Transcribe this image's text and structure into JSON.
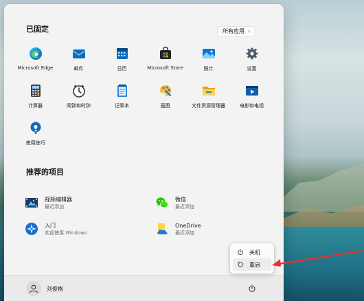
{
  "pinned": {
    "title": "已固定",
    "all_apps": "所有应用",
    "apps": [
      {
        "label": "Microsoft Edge",
        "icon": "edge-icon"
      },
      {
        "label": "邮件",
        "icon": "mail-icon"
      },
      {
        "label": "日历",
        "icon": "calendar-icon"
      },
      {
        "label": "Microsoft Store",
        "icon": "store-icon"
      },
      {
        "label": "照片",
        "icon": "photos-icon"
      },
      {
        "label": "设置",
        "icon": "settings-gear-icon"
      },
      {
        "label": "计算器",
        "icon": "calculator-icon"
      },
      {
        "label": "闹钟和时钟",
        "icon": "clock-icon"
      },
      {
        "label": "记事本",
        "icon": "notepad-icon"
      },
      {
        "label": "画图",
        "icon": "paint-icon"
      },
      {
        "label": "文件资源管理器",
        "icon": "file-explorer-icon"
      },
      {
        "label": "电影和电视",
        "icon": "movies-tv-icon"
      },
      {
        "label": "使用技巧",
        "icon": "tips-icon"
      }
    ]
  },
  "recommended": {
    "title": "推荐的项目",
    "items": [
      {
        "title": "视频编辑器",
        "subtitle": "最近添加",
        "icon": "video-editor-icon"
      },
      {
        "title": "微信",
        "subtitle": "最近添加",
        "icon": "wechat-icon"
      },
      {
        "title": "入门",
        "subtitle": "欢迎使用 Windows",
        "icon": "get-started-icon"
      },
      {
        "title": "OneDrive",
        "subtitle": "最近添加",
        "icon": "onedrive-icon"
      }
    ]
  },
  "footer": {
    "user_name": "刘俊格"
  },
  "power_menu": {
    "shutdown": "关机",
    "restart": "重启"
  },
  "colors": {
    "arrow": "#e0342f",
    "accent": "#0a64c8"
  }
}
